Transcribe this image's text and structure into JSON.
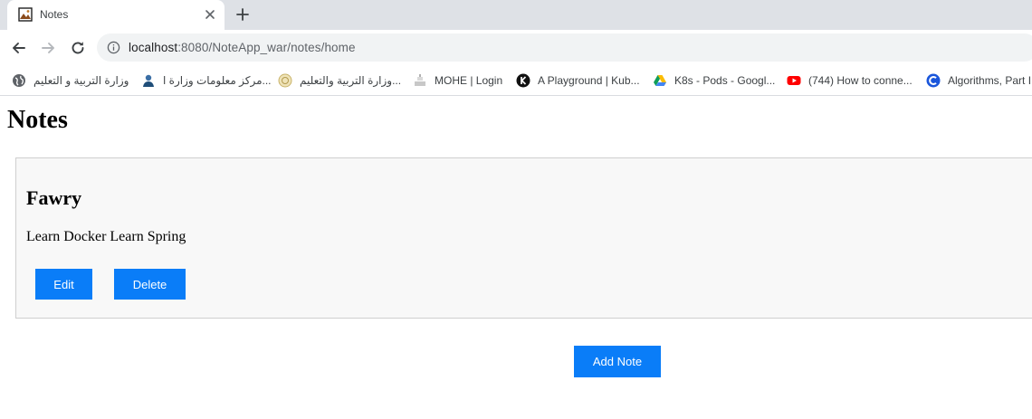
{
  "browser": {
    "tab": {
      "title": "Notes",
      "favicon": "image-favicon-icon"
    },
    "toolbar": {
      "url_host": "localhost",
      "url_rest": ":8080/NoteApp_war/notes/home"
    },
    "bookmarks": [
      {
        "label": "وزارة التربية و التعليم",
        "icon": "globe-icon"
      },
      {
        "label": "مركز معلومات وزارة ا...",
        "icon": "person-icon"
      },
      {
        "label": "وزارة التربية والتعليم...",
        "icon": "emblem-icon"
      },
      {
        "label": "MOHE | Login",
        "icon": "mohe-icon"
      },
      {
        "label": "A Playground | Kub...",
        "icon": "k-logo-icon"
      },
      {
        "label": "K8s - Pods - Googl...",
        "icon": "drive-icon"
      },
      {
        "label": "(744) How to conne...",
        "icon": "youtube-icon"
      },
      {
        "label": "Algorithms, Part I",
        "icon": "c-logo-icon"
      }
    ]
  },
  "page": {
    "title": "Notes",
    "notes": [
      {
        "title": "Fawry",
        "body": "Learn Docker Learn Spring",
        "edit_label": "Edit",
        "delete_label": "Delete"
      }
    ],
    "add_note_label": "Add Note"
  },
  "colors": {
    "primary_button": "#0a7df8",
    "card_background": "#f8f8f8",
    "card_border": "#cfcfcf"
  }
}
